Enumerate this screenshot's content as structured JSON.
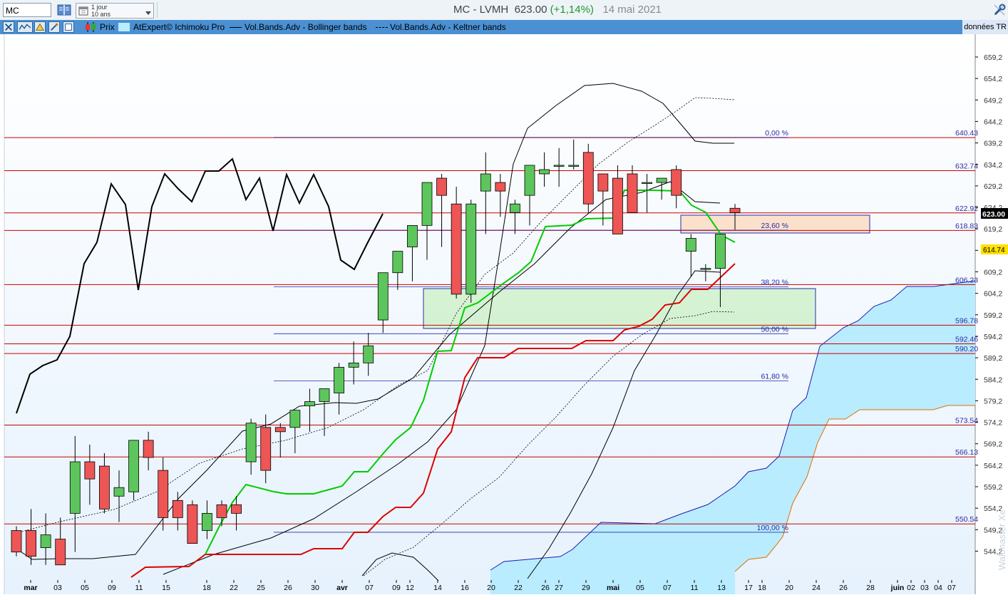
{
  "toolbar": {
    "symbol_value": "MC",
    "period_line1": "1 jour",
    "period_line2": "10 ans",
    "instrument": "MC - LVMH",
    "last_price": "623.00",
    "change": "(+1,14%)",
    "date": "14 mai 2021",
    "icons": [
      "book-icon",
      "calendar-icon",
      "wrench-icon"
    ]
  },
  "legend": {
    "prix": "Prix",
    "ichimoku": "AtExpert© Ichimoku Pro",
    "bollinger": "Vol.Bands.Adv - Bollinger bands",
    "keltner": "Vol.Bands.Adv - Keltner bands",
    "source": "données TR",
    "tool_icons": [
      "tools-icon",
      "indicator-icon",
      "drawing-icon",
      "draw-icon",
      "square-icon"
    ]
  },
  "chart_data": {
    "type": "candlestick",
    "y_ticks": [
      "659,2",
      "654,2",
      "649,2",
      "644,2",
      "639,2",
      "634,2",
      "629,2",
      "624,2",
      "619,2",
      "614,2",
      "609,2",
      "604,2",
      "599,2",
      "594,2",
      "589,2",
      "584,2",
      "579,2",
      "574,2",
      "569,2",
      "564,2",
      "559,2",
      "554,2",
      "549,2",
      "544,2"
    ],
    "ylim": [
      541.4,
      662.8
    ],
    "x_ticks": [
      "mar",
      "03",
      "05",
      "09",
      "11",
      "15",
      "18",
      "22",
      "25",
      "26",
      "30",
      "avr",
      "07",
      "09",
      "12",
      "14",
      "16",
      "20",
      "22",
      "26",
      "27",
      "29",
      "mai",
      "05",
      "07",
      "11",
      "13",
      "17",
      "18",
      "20",
      "24",
      "26",
      "28",
      "juin",
      "02",
      "03",
      "04",
      "07"
    ],
    "price_tag": "623.00",
    "level_tag": "614.74",
    "horizontal_levels": [
      "640.43",
      "632.74",
      "622.92",
      "618.83",
      "606.23",
      "596.78",
      "592.46",
      "590.20",
      "573.54",
      "566.13",
      "550.54"
    ],
    "fibonacci": [
      {
        "label": "0,00 %",
        "price": 640.5
      },
      {
        "label": "23,60 %",
        "price": 618.9
      },
      {
        "label": "38,20 %",
        "price": 605.7
      },
      {
        "label": "50,00 %",
        "price": 594.8
      },
      {
        "label": "61,80 %",
        "price": 583.8
      },
      {
        "label": "100,00 %",
        "price": 548.6
      }
    ],
    "candles": [
      [
        549,
        550,
        543,
        544
      ],
      [
        549,
        554,
        541,
        543
      ],
      [
        545,
        553,
        541,
        548
      ],
      [
        547,
        552,
        544,
        541
      ],
      [
        553,
        571,
        544,
        565
      ],
      [
        565,
        569,
        555,
        561
      ],
      [
        564,
        567,
        553,
        554
      ],
      [
        557,
        563,
        551,
        559
      ],
      [
        558,
        566,
        556,
        570
      ],
      [
        570,
        572,
        563,
        566
      ],
      [
        563,
        566,
        549,
        552
      ],
      [
        556,
        558,
        549,
        552
      ],
      [
        555,
        556,
        549,
        546
      ],
      [
        549,
        556,
        547,
        553
      ],
      [
        555,
        556,
        550,
        552
      ],
      [
        555,
        557,
        549,
        553
      ],
      [
        565,
        575,
        562,
        574
      ],
      [
        573,
        576,
        560,
        563
      ],
      [
        573,
        574,
        566,
        572
      ],
      [
        573,
        577,
        567,
        577
      ],
      [
        578,
        582,
        572,
        579
      ],
      [
        579,
        582,
        571,
        582
      ],
      [
        581,
        588,
        576,
        587
      ],
      [
        587,
        593,
        583,
        588
      ],
      [
        588,
        595,
        585,
        592
      ],
      [
        598,
        604,
        595,
        609
      ],
      [
        609,
        612,
        605,
        614
      ],
      [
        615,
        620,
        607,
        620
      ],
      [
        620,
        630,
        612,
        630
      ],
      [
        631,
        632,
        615,
        627
      ],
      [
        625,
        629,
        603,
        604
      ],
      [
        604,
        626,
        602,
        625
      ],
      [
        628,
        637,
        618,
        632
      ],
      [
        630,
        632,
        622,
        628
      ],
      [
        623,
        626,
        618,
        625
      ],
      [
        627,
        633,
        620,
        634
      ],
      [
        632,
        637,
        629,
        633
      ],
      [
        634,
        638,
        629,
        634
      ],
      [
        634,
        640,
        633,
        634
      ],
      [
        637,
        639,
        623,
        625
      ],
      [
        632,
        632,
        620,
        628
      ],
      [
        631,
        634,
        620,
        618
      ],
      [
        632,
        634,
        623,
        623
      ],
      [
        630,
        632,
        623,
        630
      ],
      [
        630,
        631,
        626,
        631
      ],
      [
        633,
        634,
        624,
        627
      ],
      [
        614,
        618,
        608,
        617
      ],
      [
        610,
        611,
        607,
        610
      ],
      [
        610,
        612,
        601,
        618
      ],
      [
        624,
        625,
        619,
        623
      ]
    ],
    "series": [
      {
        "name": "Prix",
        "values": []
      },
      {
        "name": "AtExpert© Ichimoku Pro",
        "values": []
      },
      {
        "name": "Vol.Bands.Adv - Bollinger bands",
        "values": []
      },
      {
        "name": "Vol.Bands.Adv - Keltner bands",
        "values": []
      }
    ],
    "colors": {
      "up": "#5cc65c",
      "down": "#ee5555",
      "cloud": "#b9ecff",
      "grid_bg": "#eef6ff",
      "level": "#cc0000",
      "fibo": "#2b2ba6",
      "tenkan": "#00cc00",
      "kijun": "#dd0000"
    }
  }
}
